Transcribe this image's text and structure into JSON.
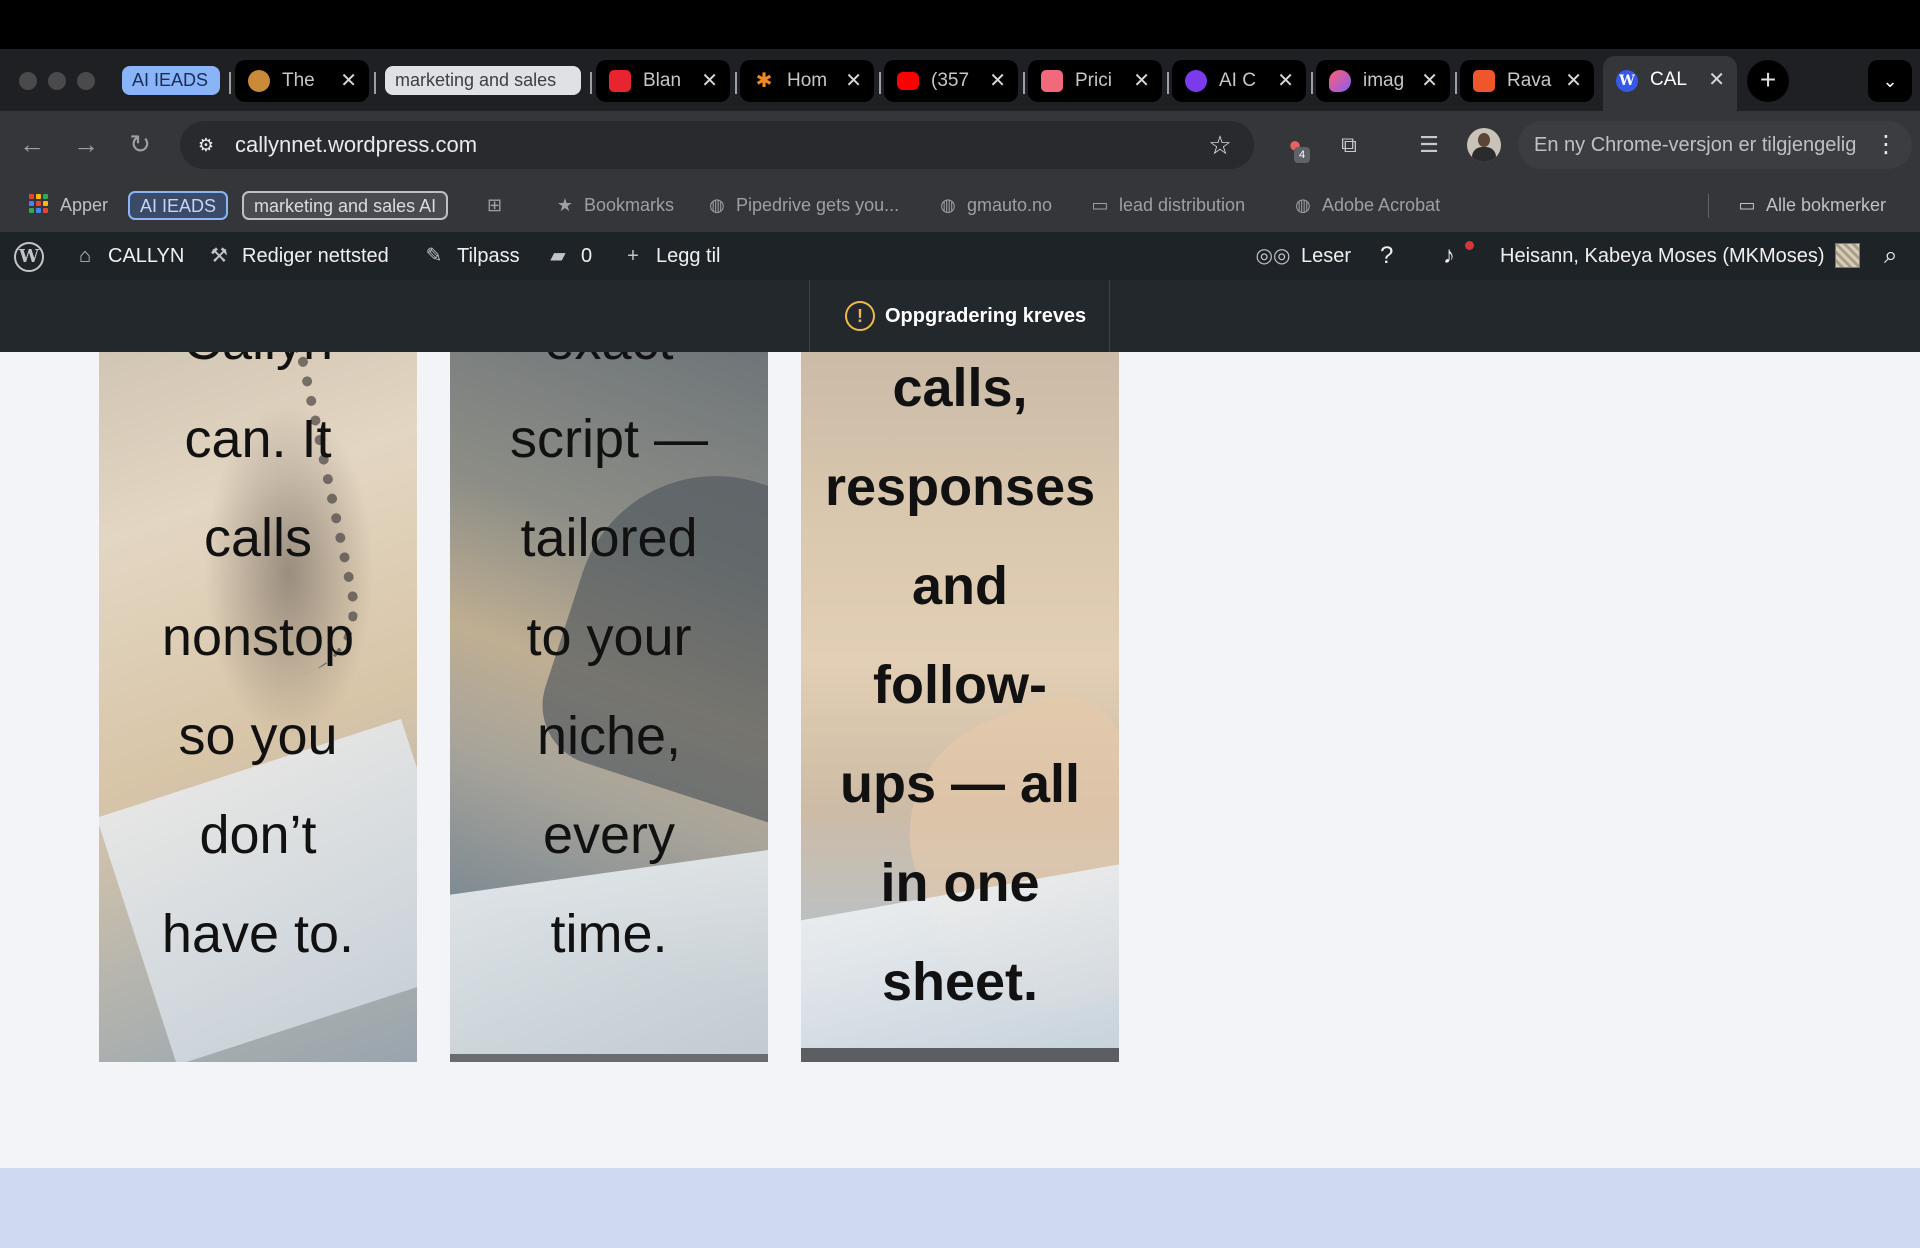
{
  "browser": {
    "tab_groups": [
      {
        "label": "AI IEADS",
        "color": "#8ab4f8"
      },
      {
        "label": "marketing and sales",
        "color": "#dfe1e5"
      }
    ],
    "tabs": [
      {
        "title": "The"
      },
      {
        "title": "Blan"
      },
      {
        "title": "Hom"
      },
      {
        "title": "(357"
      },
      {
        "title": "Prici"
      },
      {
        "title": "AI C"
      },
      {
        "title": "imag"
      },
      {
        "title": "Rava"
      },
      {
        "title": "CAL",
        "active": true
      }
    ],
    "url": "callynnet.wordpress.com",
    "extension_badge": "4",
    "update_notice": "En ny Chrome-versjon er tilgjengelig"
  },
  "bookmarks": {
    "apps": "Apper",
    "group_ai": "AI IEADS",
    "group_marketing": "marketing and sales AI",
    "items": [
      "Bookmarks",
      "Pipedrive gets you...",
      "gmauto.no",
      "lead distribution",
      "Adobe Acrobat"
    ],
    "all_bookmarks": "Alle bokmerker"
  },
  "wp_admin_bar": {
    "site_name": "CALLYN",
    "edit_site": "Rediger nettsted",
    "customize": "Tilpass",
    "comments_count": "0",
    "add_new": "Legg til",
    "reader": "Leser",
    "greeting": "Heisann, Kabeya Moses (MKMoses)"
  },
  "notice": {
    "text": "Oppgradering kreves"
  },
  "cards": [
    {
      "lines": [
        "Callyn",
        "can. It",
        "calls",
        "nonstop",
        "so you",
        "don’t",
        "have to."
      ]
    },
    {
      "lines": [
        "exact",
        "script —",
        "tailored",
        "to your",
        "niche,",
        "every",
        "time."
      ]
    },
    {
      "lines": [
        "calls,",
        "responses",
        "and",
        "follow-",
        "ups — all",
        "in one",
        "sheet."
      ]
    }
  ],
  "colors": {
    "wp_bar": "#1d2327",
    "page_bg": "#f3f4f7",
    "footer_bg": "#cfd9f0",
    "warning": "#f0b849"
  }
}
